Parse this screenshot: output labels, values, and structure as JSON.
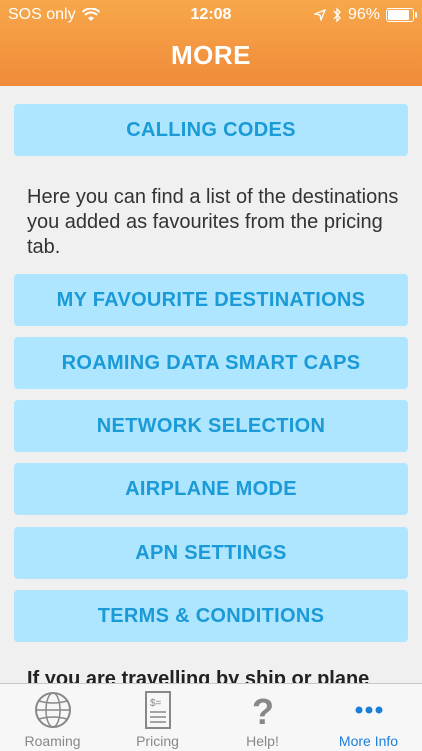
{
  "status": {
    "carrier": "SOS only",
    "time": "12:08",
    "battery": "96%",
    "battery_level": 0.96
  },
  "header": {
    "title": "MORE"
  },
  "buttons": {
    "calling_codes": "CALLING CODES",
    "favourites": "MY FAVOURITE DESTINATIONS",
    "roaming_caps": "ROAMING DATA SMART CAPS",
    "network": "NETWORK SELECTION",
    "airplane": "AIRPLANE MODE",
    "apn": "APN SETTINGS",
    "terms": "TERMS & CONDITIONS"
  },
  "description": "Here you can find a list of the destinations you added as favourites from the pricing tab.",
  "cut_text": "If you are travelling by ship or plane",
  "tabs": [
    {
      "label": "Roaming",
      "icon": "globe-icon"
    },
    {
      "label": "Pricing",
      "icon": "price-list-icon"
    },
    {
      "label": "Help!",
      "icon": "question-icon"
    },
    {
      "label": "More Info",
      "icon": "more-icon"
    }
  ],
  "colors": {
    "header": "#f39a42",
    "button": "#aee5ff",
    "button_text": "#1a9ad6",
    "active_tab": "#1a7fd6"
  }
}
